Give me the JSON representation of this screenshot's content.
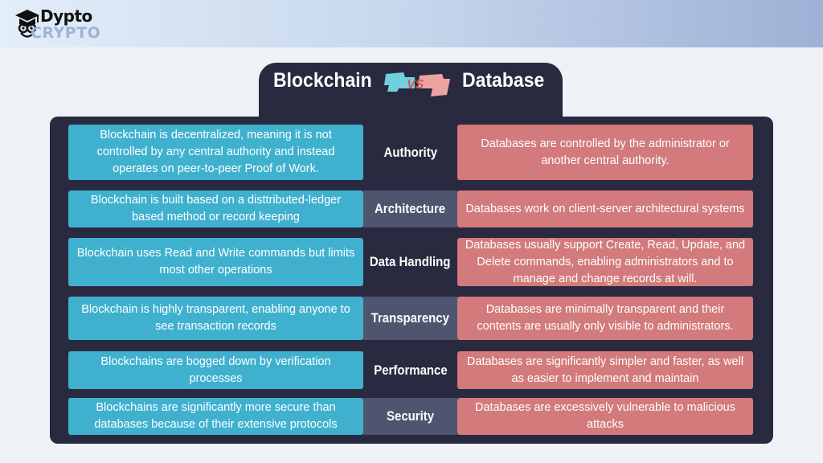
{
  "brand": {
    "logo_icon": "graduation-cap-owl-icon",
    "name_top": "Dypto",
    "name_bottom": "CRYPTO"
  },
  "header": {
    "left_title": "Blockchain",
    "vs_label": "VS",
    "right_title": "Database"
  },
  "colors": {
    "blockchain": "#3fb1cf",
    "database": "#d27a7c",
    "panel": "#292a40",
    "label_shaded": "#4f556e"
  },
  "rows": [
    {
      "category": "Authority",
      "blockchain": "Blockchain is decentralized, meaning it is not controlled by any central authority and instead operates on peer-to-peer Proof of Work.",
      "database": "Databases are controlled by the administrator or another central authority."
    },
    {
      "category": "Architecture",
      "blockchain": "Blockchain is built based on a disttributed-ledger based method or record keeping",
      "database": "Databases work on client-server architectural systems"
    },
    {
      "category": "Data Handling",
      "blockchain": "Blockchain uses Read and Write commands but limits most other operations",
      "database": "Databases usually support Create, Read, Update, and Delete commands, enabling administrators and to manage and change records at will."
    },
    {
      "category": "Transparency",
      "blockchain": "Blockchain is highly transparent, enabling anyone to see transaction records",
      "database": "Databases are minimally transparent and their contents are usually only visible to administrators."
    },
    {
      "category": "Performance",
      "blockchain": "Blockchains are bogged down by verification processes",
      "database": "Databases are significantly simpler and faster, as well as easier to implement and maintain"
    },
    {
      "category": "Security",
      "blockchain": "Blockchains are significantly more secure than databases because of their extensive protocols",
      "database": "Databases are excessively vulnerable to malicious attacks"
    }
  ]
}
